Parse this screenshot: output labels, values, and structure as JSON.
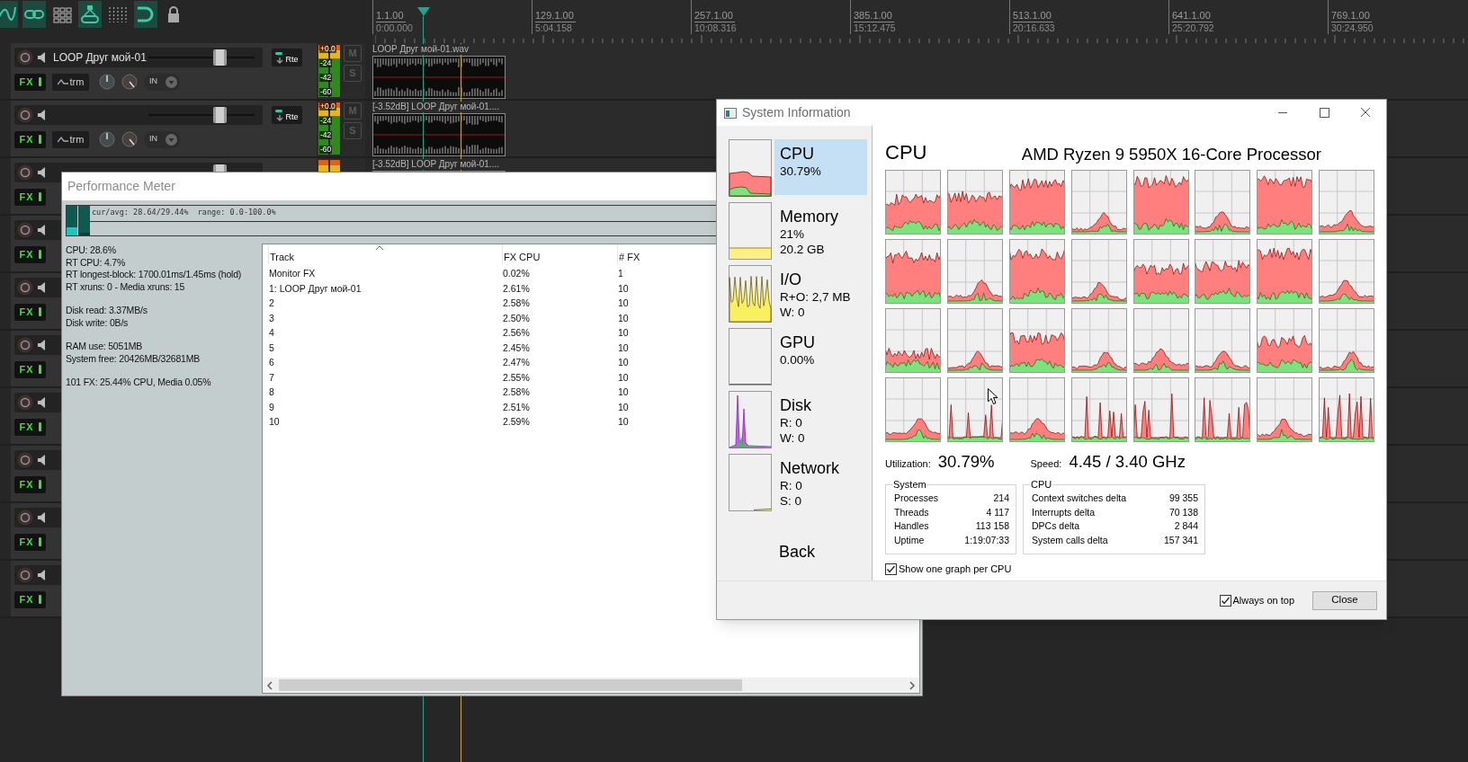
{
  "toolbar": [
    {
      "kind": "curve",
      "on": true
    },
    {
      "kind": "link",
      "on": true
    },
    {
      "kind": "grid",
      "on": false
    },
    {
      "kind": "group",
      "on": true
    },
    {
      "kind": "dots",
      "on": false
    },
    {
      "kind": "snap",
      "on": true
    },
    {
      "kind": "lock",
      "on": false
    }
  ],
  "ruler": [
    {
      "bar": "1.1.00",
      "time": "0:00.000"
    },
    {
      "bar": "129.1.00",
      "time": "5:04.158"
    },
    {
      "bar": "257.1.00",
      "time": "10:08.316"
    },
    {
      "bar": "385.1.00",
      "time": "15:12.475"
    },
    {
      "bar": "513.1.00",
      "time": "20:16.633"
    },
    {
      "bar": "641.1.00",
      "time": "25:20.792"
    },
    {
      "bar": "769.1.00",
      "time": "30:24.950"
    }
  ],
  "tracks": [
    {
      "name": "LOOP Друг мой-01",
      "level": 0.68,
      "route_label": "Rte",
      "fx_label": "FX",
      "trim_label": "trm",
      "input_label": "IN",
      "meter_labels": [
        "+0.0",
        "-24",
        "-42",
        "-60"
      ],
      "mute_label": "M",
      "solo_label": "S",
      "item_title": "LOOP Друг мой-01.wav"
    },
    {
      "level": 0.68,
      "route_label": "Rte",
      "fx_label": "FX",
      "trim_label": "trm",
      "input_label": "IN",
      "meter_labels": [
        "+0.0",
        "-24",
        "-42",
        "-60"
      ],
      "mute_label": "M",
      "solo_label": "S",
      "item_title": "[-3.52dB] LOOP Друг мой-01...."
    },
    {
      "level": 0.68,
      "fx_label": "FX",
      "item_title": "[-3.52dB] LOOP Друг мой-01...."
    },
    {
      "fx_label": "FX"
    },
    {
      "fx_label": "FX"
    },
    {
      "fx_label": "FX"
    },
    {
      "fx_label": "FX"
    },
    {
      "fx_label": "FX"
    },
    {
      "fx_label": "FX"
    },
    {
      "fx_label": "FX"
    }
  ],
  "performance_meter": {
    "title": "Performance Meter",
    "graph_caption": "cur/avg: 28.64/29.44%  range: 0.0-100.0%",
    "stats": [
      [
        "CPU: 28.6%",
        "RT CPU: 4.7%",
        "RT longest-block: 1700.01ms/1.45ms (hold)",
        "RT xruns: 0 - Media xruns: 15"
      ],
      [
        "Disk read: 3.37MB/s",
        "Disk write: 0B/s"
      ],
      [
        "RAM use: 5051MB",
        "System free: 20426MB/32681MB"
      ],
      [
        "101 FX: 25.44% CPU, Media 0.05%"
      ]
    ],
    "columns": [
      "Track",
      "FX CPU",
      "# FX"
    ],
    "rows": [
      [
        "Monitor FX",
        "0.02%",
        "1"
      ],
      [
        "1: LOOP Друг мой-01",
        "2.61%",
        "10"
      ],
      [
        "2",
        "2.58%",
        "10"
      ],
      [
        "3",
        "2.50%",
        "10"
      ],
      [
        "4",
        "2.56%",
        "10"
      ],
      [
        "5",
        "2.45%",
        "10"
      ],
      [
        "6",
        "2.47%",
        "10"
      ],
      [
        "7",
        "2.55%",
        "10"
      ],
      [
        "8",
        "2.58%",
        "10"
      ],
      [
        "9",
        "2.51%",
        "10"
      ],
      [
        "10",
        "2.59%",
        "10"
      ]
    ]
  },
  "system_information": {
    "title": "System Information",
    "sidebar": [
      {
        "kind": "cpu",
        "label": "CPU",
        "lines": [
          "30.79%"
        ],
        "selected": true
      },
      {
        "kind": "memory",
        "label": "Memory",
        "lines": [
          "21%",
          "20.2 GB"
        ],
        "selected": false
      },
      {
        "kind": "io",
        "label": "I/O",
        "lines": [
          "R+O: 2,7 MB",
          "W: 0"
        ],
        "selected": false
      },
      {
        "kind": "gpu",
        "label": "GPU",
        "lines": [
          "0.00%"
        ],
        "selected": false
      },
      {
        "kind": "disk",
        "label": "Disk",
        "lines": [
          "R: 0",
          "W: 0"
        ],
        "selected": false
      },
      {
        "kind": "network",
        "label": "Network",
        "lines": [
          "R: 0",
          "S: 0"
        ],
        "selected": false
      }
    ],
    "back": "Back",
    "heading": "CPU",
    "processor": "AMD Ryzen 9 5950X 16-Core Processor",
    "utilization_label": "Utilization:",
    "utilization": "30.79%",
    "speed_label": "Speed:",
    "speed": "4.45 / 3.40 GHz",
    "system_group": {
      "title": "System",
      "rows": [
        [
          "Processes",
          "214"
        ],
        [
          "Threads",
          "4 117"
        ],
        [
          "Handles",
          "113 158"
        ],
        [
          "Uptime",
          "1:19:07:33"
        ]
      ]
    },
    "cpu_group": {
      "title": "CPU",
      "rows": [
        [
          "Context switches delta",
          "99 355"
        ],
        [
          "Interrupts delta",
          "70 138"
        ],
        [
          "DPCs delta",
          "2 844"
        ],
        [
          "System calls delta",
          "157 341"
        ]
      ]
    },
    "one_graph_per_cpu": {
      "label": "Show one graph per CPU",
      "checked": true
    },
    "always_on_top": {
      "label": "Always on top",
      "checked": true
    },
    "close_button": "Close"
  }
}
